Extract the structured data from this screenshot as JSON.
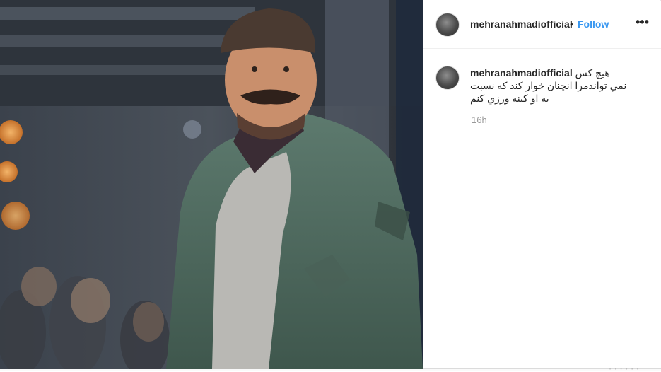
{
  "post": {
    "username": "mehranahmadiofficial",
    "separator": "•",
    "follow_label": "Follow",
    "more_icon": "more-options-icon"
  },
  "comment": {
    "username": "mehranahmadiofficial",
    "caption": "هيچ کس نمي تواندمرا انچنان خوار کند که نسبت به او کينه ورزي کنم",
    "time": "16h"
  },
  "colors": {
    "link": "#3897f0",
    "text": "#262626",
    "muted": "#999999",
    "border": "#dbdbdb"
  }
}
